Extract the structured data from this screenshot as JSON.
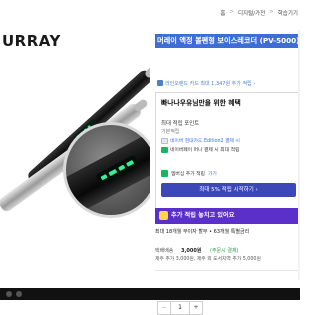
{
  "nav": {
    "home": "홈",
    "sep": ">",
    "category": "디지털/가전",
    "sub": "학습기기"
  },
  "product": {
    "brand": "URRAY",
    "title": "머레이 액정 볼펜형 보이스레코더 (PV-5000)",
    "promo": "라인오랜드 카드 최대 1,347원 추가 적립 ›"
  },
  "benefits": {
    "title": "빠나나우유님만을 위한 혜택",
    "max_points_label": "최대 적립 포인트",
    "base_label": "기본적립",
    "line1": "네이버 현대카드 Edition2 결제 시",
    "line2": "네이버페이 머니 결제 시 최대 적립",
    "pay_text": "멤버십 추가 적립",
    "pay_go": "가기",
    "accumulate_btn": "최대 5% 적립 시작하기 ›",
    "chevron": "∨"
  },
  "banner": {
    "text": "추가 적립 놓치고 있어요"
  },
  "order": {
    "summary": "최대 18개월 무이자 할부 • 63개월 특별금리",
    "price_label": "택배배송",
    "price_value": "3,000원",
    "price_note": "(주문시 결제)",
    "delivery": "제주 추가 3,000원, 제주 외 도서지역 추가 5,000원",
    "quantity": "1",
    "minus": "−",
    "plus": "+"
  },
  "colors": {
    "title_bg": "#3e6dd6",
    "accent_blue": "#3b6fe0",
    "button": "#3d48b8",
    "banner": "#5b2fc9",
    "naverpay_green": "#0bbd5c"
  }
}
